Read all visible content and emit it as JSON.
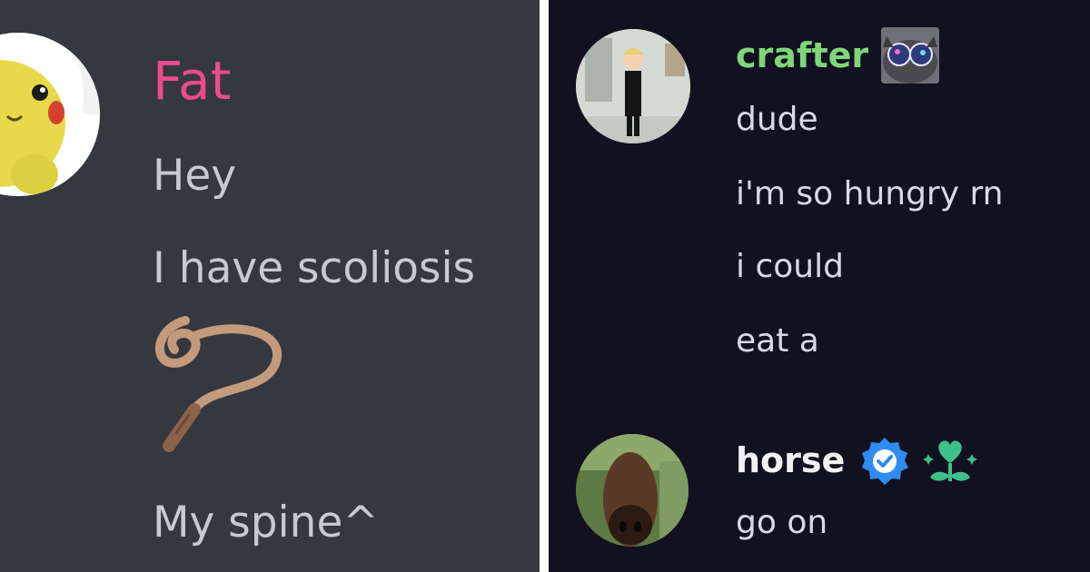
{
  "left_chat": {
    "author": {
      "name": "Fat",
      "name_color": "#ec4a8f",
      "avatar": "pikachu-plush-avatar"
    },
    "messages": [
      {
        "text": "Hey"
      },
      {
        "text": "I have scoliosis"
      },
      {
        "emoji": "rope-emoji"
      },
      {
        "text": "My spine^"
      }
    ]
  },
  "right_chat": {
    "groups": [
      {
        "author": {
          "name": "crafter",
          "name_color": "#7fd57a",
          "avatar": "cartoon-character-avatar",
          "badge": "glasses-cat-badge"
        },
        "messages": [
          "dude",
          "i'm so hungry rn",
          "i could",
          "eat a"
        ]
      },
      {
        "author": {
          "name": "horse",
          "name_color": "#f2f2f6",
          "avatar": "horse-face-avatar",
          "badges": [
            "verified-icon",
            "heart-plant-icon"
          ]
        },
        "messages": [
          "go on"
        ]
      }
    ]
  },
  "theme": {
    "left_background": "#36383f",
    "right_background": "#11111f",
    "verified_blue": "#2f8cf2",
    "badge_green": "#3fbf8a"
  }
}
